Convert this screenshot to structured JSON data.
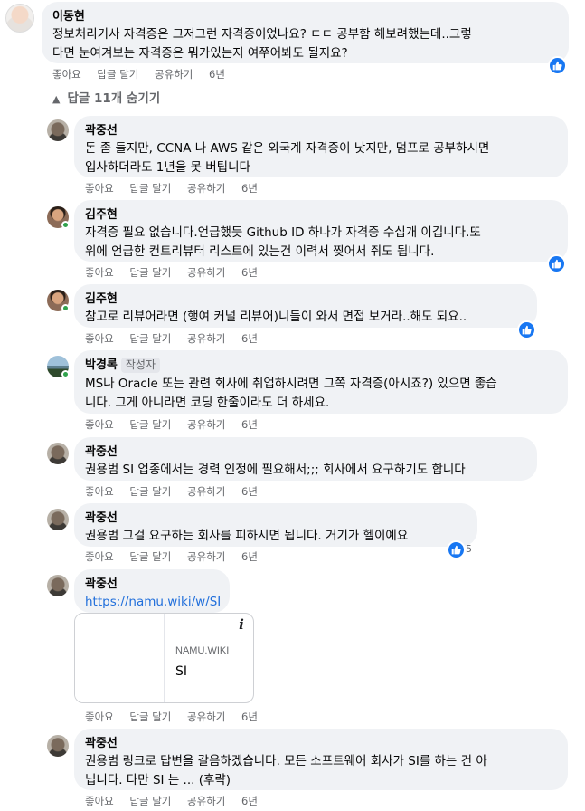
{
  "main_comment": {
    "author": "이동현",
    "text": "정보처리기사 자격증은 그저그런 자격증이었나요? ㄷㄷ 공부함 해보려했는데..그렇\n다면 눈여겨보는 자격증은 뭐가있는지 여쭈어봐도 될지요?",
    "like": "좋아요",
    "reply": "답글 달기",
    "share": "공유하기",
    "time": "6년"
  },
  "replies_toggle": "답글 11개 숨기기",
  "replies": [
    {
      "author": "곽중선",
      "text": "돈 좀 들지만, CCNA 나 AWS 같은 외국계 자격증이 낫지만, 덤프로 공부하시면\n입사하더라도 1년을 못 버팁니다",
      "like": "좋아요",
      "reply": "답글 달기",
      "share": "공유하기",
      "time": "6년"
    },
    {
      "author": "김주현",
      "text": "자격증 필요 없습니다.언급했듯 Github ID 하나가 자격증 수십개 이깁니다.또\n위에 언급한 컨트리뷰터 리스트에 있는건 이력서 찢어서 줘도 됩니다.",
      "like": "좋아요",
      "reply": "답글 달기",
      "share": "공유하기",
      "time": "6년"
    },
    {
      "author": "김주현",
      "text": "참고로 리뷰어라면 (행여 커널 리뷰어)니들이 와서 면접 보거라..해도 되요..",
      "like": "좋아요",
      "reply": "답글 달기",
      "share": "공유하기",
      "time": "6년"
    },
    {
      "author": "박경록",
      "badge": "작성자",
      "text": "MS나 Oracle 또는 관련 회사에 취업하시려면 그쪽 자격증(아시죠?) 있으면 좋습\n니다. 그게 아니라면 코딩 한줄이라도 더 하세요.",
      "like": "좋아요",
      "reply": "답글 달기",
      "share": "공유하기",
      "time": "6년"
    },
    {
      "author": "곽중선",
      "text": "권용범 SI 업종에서는 경력 인정에 필요해서;;; 회사에서 요구하기도 합니다",
      "like": "좋아요",
      "reply": "답글 달기",
      "share": "공유하기",
      "time": "6년"
    },
    {
      "author": "곽중선",
      "text": "권용범 그걸 요구하는 회사를 피하시면 됩니다. 거기가 헬이예요",
      "like": "좋아요",
      "reply": "답글 달기",
      "share": "공유하기",
      "time": "6년",
      "like_count": "5"
    },
    {
      "author": "곽중선",
      "link": "https://namu.wiki/w/SI",
      "preview_site": "NAMU.WIKI",
      "preview_title": "SI",
      "like": "좋아요",
      "reply": "답글 달기",
      "share": "공유하기",
      "time": "6년"
    },
    {
      "author": "곽중선",
      "text": "권용범 링크로 답변을 갈음하겠습니다. 모든 소프트웨어 회사가 SI를 하는 건 아\n닙니다. 다만 SI 는 ... (후략)",
      "like": "좋아요",
      "reply": "답글 달기",
      "share": "공유하기",
      "time": "6년"
    }
  ],
  "colors": {
    "like_blue": "#1877f2",
    "bubble_bg": "#f0f2f5",
    "meta_gray": "#65676b",
    "link": "#216fdb"
  }
}
